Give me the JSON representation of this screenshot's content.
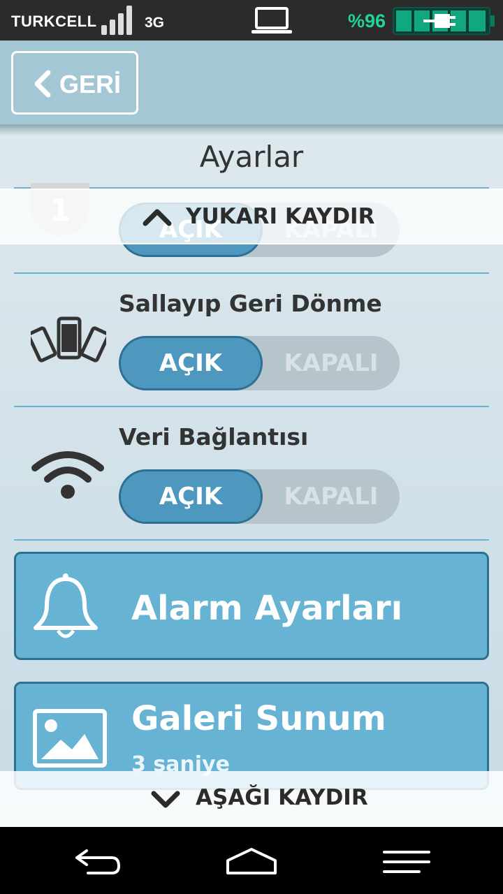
{
  "status_bar": {
    "carrier": "TURKCELL",
    "network": "3G",
    "battery_percent": "%96",
    "signal_icon": "signal-bars-icon",
    "laptop_icon": "laptop-icon",
    "battery_icon": "battery-charging-icon"
  },
  "header": {
    "back_label": "GERİ",
    "back_icon": "chevron-left-icon"
  },
  "page": {
    "title": "Ayarlar"
  },
  "scroll": {
    "up_label": "YUKARI KAYDIR",
    "down_label": "AŞAĞI KAYDIR"
  },
  "settings": [
    {
      "label": "Sallayıp Geri Dönme",
      "icon": "phones-shake-icon",
      "on_label": "AÇIK",
      "off_label": "KAPALI",
      "state": "on"
    },
    {
      "label": "Veri Bağlantısı",
      "icon": "wifi-icon",
      "on_label": "AÇIK",
      "off_label": "KAPALI",
      "state": "on"
    }
  ],
  "partial_toggle": {
    "on_label": "AÇIK",
    "off_label": "KAPALI",
    "badge": "1"
  },
  "buttons": [
    {
      "label": "Alarm Ayarları",
      "icon": "bell-icon"
    },
    {
      "label": "Galeri Sunum",
      "sub": "3 saniye",
      "icon": "image-icon"
    }
  ],
  "nav": {
    "back_icon": "nav-back-icon",
    "home_icon": "nav-home-icon",
    "menu_icon": "nav-menu-icon"
  },
  "colors": {
    "accent": "#67b3d3",
    "toggle_on": "#4e98bf",
    "battery_text": "#1fd49b"
  }
}
